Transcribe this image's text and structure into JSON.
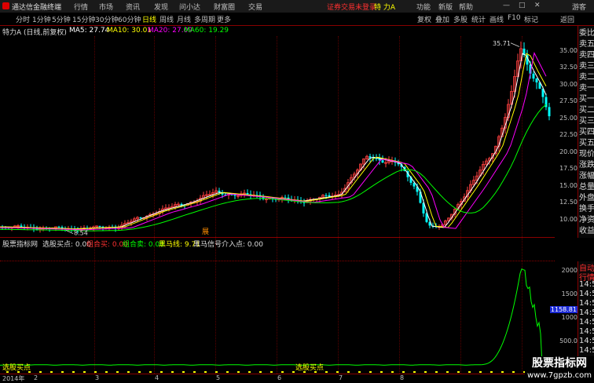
{
  "colors": {
    "bg": "#000000",
    "grid": "#800000",
    "up": "#ff4040",
    "down": "#00ffff",
    "ma5": "#ffffff",
    "ma10": "#ffff00",
    "ma20": "#ff00ff",
    "ma60": "#00ff00",
    "accent": "#ffff00",
    "link": "#ff3030"
  },
  "titlebar": {
    "app_title": "通达信金融终端",
    "menu": [
      "行情",
      "市场",
      "资讯",
      "发现",
      "问小达",
      "财富圈",
      "交易"
    ],
    "login_notice": "证券交易未登录",
    "stock_name": "特 力A",
    "right_menu": [
      "功能",
      "新版",
      "帮助",
      "游客"
    ]
  },
  "toolbar": {
    "periods": [
      "分时",
      "1分钟",
      "5分钟",
      "15分钟",
      "30分钟",
      "60分钟",
      "日线",
      "周线",
      "月线",
      "多周期",
      "更多"
    ],
    "active_period": "日线",
    "tools": [
      "复权",
      "叠加",
      "多股",
      "统计",
      "画线",
      "F10",
      "标记",
      "返回"
    ]
  },
  "infobar": {
    "stock": "特力A",
    "mode": "(日线,前复权)",
    "ma5": "MA5: 27.74",
    "ma10": "MA10: 30.01",
    "ma20": "MA20: 27.09",
    "ma60": "MA60: 19.29"
  },
  "price_axis": [
    "35.00",
    "32.50",
    "30.00",
    "27.50",
    "25.00",
    "22.50",
    "20.00",
    "17.50",
    "15.00",
    "12.50",
    "10.00"
  ],
  "price_annotations": {
    "high": "35.71",
    "low": "8.54"
  },
  "event_marker": "展",
  "right_panel_top": [
    "委比",
    "卖五",
    "卖四",
    "卖三",
    "卖二",
    "卖一",
    "买一",
    "买二",
    "买三",
    "买四",
    "买五",
    "现价",
    "涨跌",
    "涨幅",
    "总量",
    "外盘",
    "换手",
    "净资",
    "收益"
  ],
  "right_panel_bottom": [
    "自动",
    "行情",
    "14:56",
    "14:56",
    "14:56",
    "14:56",
    "14:56",
    "14:56",
    "14:56",
    "14:56",
    "14:56",
    "14:56"
  ],
  "indicator_bar": {
    "name": "股票指标网",
    "b1": "选股买点: 0.00",
    "b2": "组合买: 0.00",
    "b3": "组合卖: 0.00",
    "b4": "黑马线: 9.71",
    "b5": "黑马信号介入点: 0.00"
  },
  "indicator_axis": [
    "2000",
    "1500",
    "1000",
    "500.0"
  ],
  "indicator_value_box": "1158.81",
  "buy_labels": [
    "选股买点",
    "选股买点"
  ],
  "dates": [
    "2014年",
    "2",
    "3",
    "4",
    "5",
    "6",
    "7",
    "8"
  ],
  "watermark": {
    "line1": "股票指标网",
    "line2": "www.7gpzb.com"
  }
}
